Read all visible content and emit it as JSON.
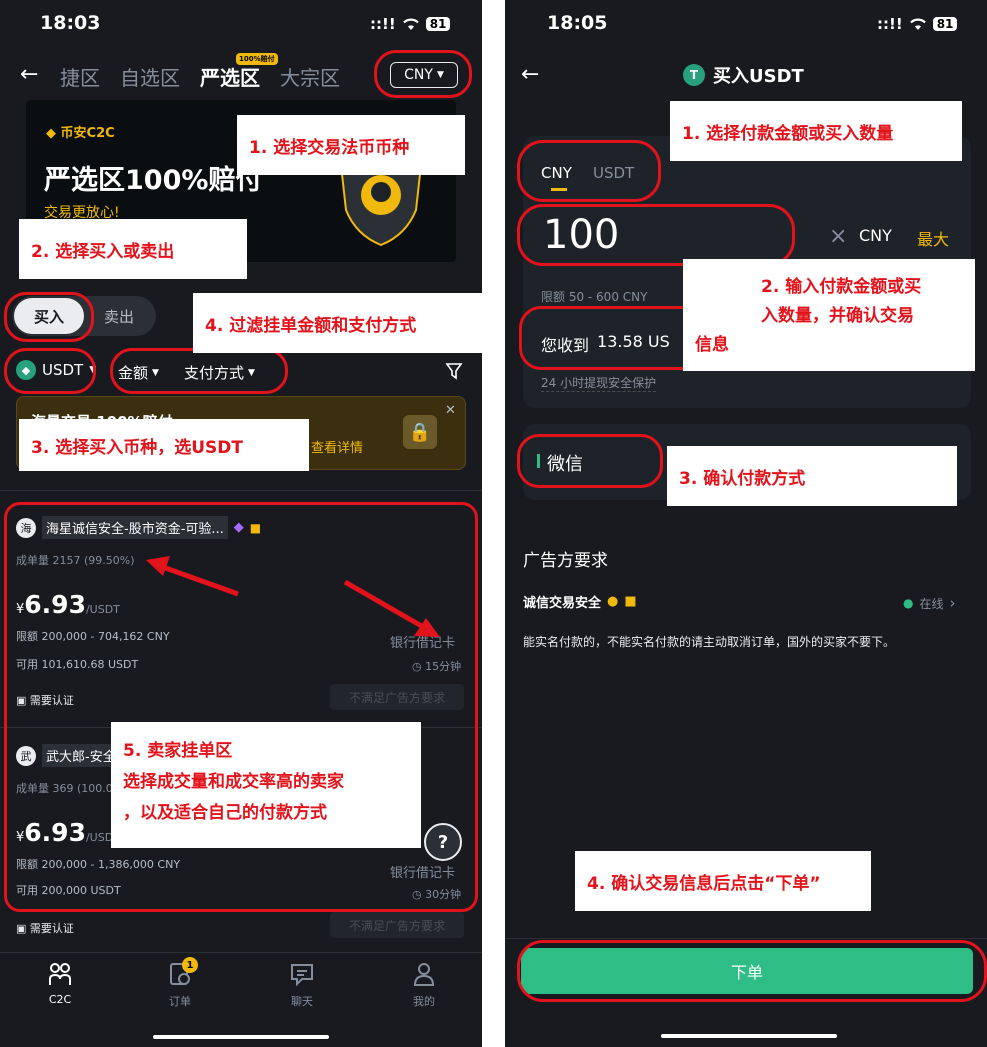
{
  "left": {
    "status": {
      "time": "18:03",
      "signal": "::!!",
      "battery": "81"
    },
    "tabs": [
      "捷区",
      "自选区",
      "严选区",
      "大宗区"
    ],
    "tab_badge": "100%赔付",
    "currency": "CNY",
    "banner": {
      "brand": "币安C2C",
      "headline": "严选区100%赔付",
      "sub": "交易更放心!"
    },
    "side_buy": "买入",
    "side_sell": "卖出",
    "filters": {
      "coin": "USDT",
      "amount": "金额",
      "payment": "支付方式"
    },
    "notice": {
      "text": "海量交易 100%赔付",
      "link": "查看详情"
    },
    "ads": [
      {
        "avatar": "海",
        "name": "海星诚信安全-股市资金-可验...",
        "stats": "成单量 2157 (99.50%)",
        "currency_sym": "¥",
        "price": "6.93",
        "unit": "/USDT",
        "limit": "限额 200,000 - 704,162 CNY",
        "available": "可用 101,610.68 USDT",
        "payment": "银行借记卡",
        "time": "15分钟",
        "verify": "需要认证",
        "requirement": "不满足广告方要求"
      },
      {
        "avatar": "武",
        "name": "武大郎-安全",
        "stats": "成单量 369 (100.0",
        "currency_sym": "¥",
        "price": "6.93",
        "unit": "/USDT",
        "limit": "限额 200,000 - 1,386,000 CNY",
        "available": "可用 200,000 USDT",
        "payment": "银行借记卡",
        "time": "30分钟",
        "verify": "需要认证",
        "requirement": "不满足广告方要求"
      }
    ],
    "help": "?",
    "nav": [
      {
        "label": "C2C",
        "icon": "c2c-icon"
      },
      {
        "label": "订单",
        "icon": "orders-icon",
        "badge": "1"
      },
      {
        "label": "聊天",
        "icon": "chat-icon"
      },
      {
        "label": "我的",
        "icon": "profile-icon"
      }
    ],
    "annotations": {
      "a1": "1. 选择交易法币币种",
      "a2": "2. 选择买入或卖出",
      "a3": "3. 选择买入币种，选USDT",
      "a4": "4. 过滤挂单金额和支付方式",
      "a5_line1": "5. 卖家挂单区",
      "a5_line2": "选择成交量和成交率高的卖家",
      "a5_line3": "，以及适合自己的付款方式"
    }
  },
  "right": {
    "status": {
      "time": "18:05",
      "signal": "::!!",
      "battery": "81"
    },
    "title": "买入USDT",
    "tabs": [
      "CNY",
      "USDT"
    ],
    "amount": "100",
    "clear": "×",
    "amount_currency": "CNY",
    "max": "最大",
    "limit": "限额 50 - 600 CNY",
    "receive_label": "您收到",
    "receive_value": "13.58 US",
    "protect": "24 小时提现安全保护",
    "payment": "微信",
    "req_title": "广告方要求",
    "merchant": "诚信交易安全",
    "online": "在线",
    "req_text": "能实名付款的，不能实名付款的请主动取消订单，国外的买家不要下。",
    "submit": "下单",
    "annotations": {
      "a1": "1. 选择付款金额或买入数量",
      "a2_line1": "2. 输入付款金额或买",
      "a2_line2": "入数量，并确认交易",
      "a2_line3": "信息",
      "a3": "3. 确认付款方式",
      "a4": "4. 确认交易信息后点击“下单”"
    }
  },
  "colors": {
    "bg": "#181a20",
    "card": "#1e2329",
    "accent": "#f0b90b",
    "green": "#2ebd85",
    "annotation": "#e3131b"
  }
}
